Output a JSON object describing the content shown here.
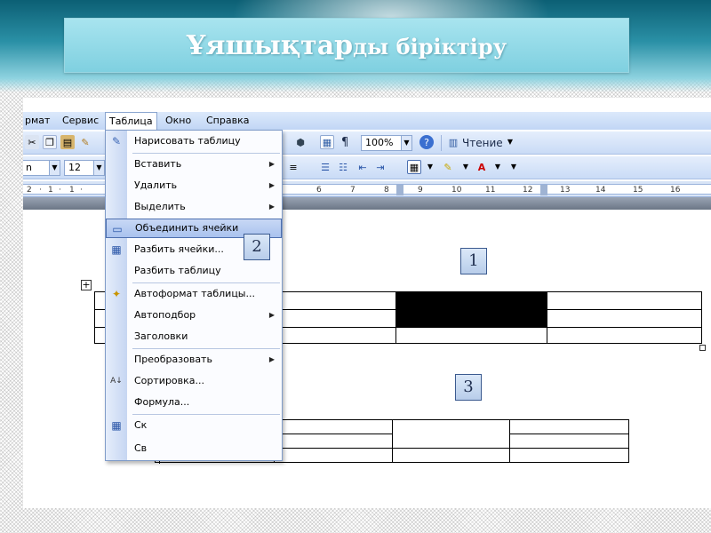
{
  "slide": {
    "title_part1": "Ұяшықтар",
    "title_part2": "ды біріктіру"
  },
  "menubar": {
    "items": [
      "рмат",
      "Сервис",
      "Таблица",
      "Окно",
      "Справка"
    ]
  },
  "toolbar1": {
    "zoom": "100%",
    "reading_label": "Чтение",
    "paragraph_mark": "¶"
  },
  "toolbar2": {
    "style_value": "n",
    "font_size_value": "12"
  },
  "ruler": {
    "left_labels": [
      "2",
      "·",
      "1",
      "·",
      "1",
      "·"
    ],
    "right_labels": [
      "6",
      "7",
      "8",
      "9",
      "10",
      "11",
      "12",
      "13",
      "14",
      "15",
      "16"
    ]
  },
  "context_menu": {
    "items": [
      {
        "label": "Нарисовать таблицу",
        "icon": "pencil-icon"
      },
      {
        "label": "Вставить",
        "submenu": true
      },
      {
        "label": "Удалить",
        "submenu": true
      },
      {
        "label": "Выделить",
        "submenu": true
      },
      {
        "label": "Объединить ячейки",
        "icon": "merge-cells-icon",
        "highlighted": true
      },
      {
        "label": "Разбить ячейки...",
        "icon": "split-cells-icon"
      },
      {
        "label": "Разбить таблицу"
      },
      {
        "label": "Автоформат таблицы...",
        "icon": "autoformat-icon"
      },
      {
        "label": "Автоподбор",
        "submenu": true
      },
      {
        "label": "Заголовки"
      },
      {
        "label": "Преобразовать",
        "submenu": true
      },
      {
        "label": "Сортировка...",
        "icon": "sort-az-icon"
      },
      {
        "label": "Формула..."
      },
      {
        "label": "Ск",
        "icon": "grid-icon"
      },
      {
        "label": "Св"
      }
    ]
  },
  "callouts": [
    "1",
    "2",
    "3"
  ],
  "colors": {
    "banner": "#2a90a6",
    "title_box": "#a8e4ef",
    "menu_highlight": "#a9c2ee",
    "toolbar": "#c9dbf6"
  }
}
